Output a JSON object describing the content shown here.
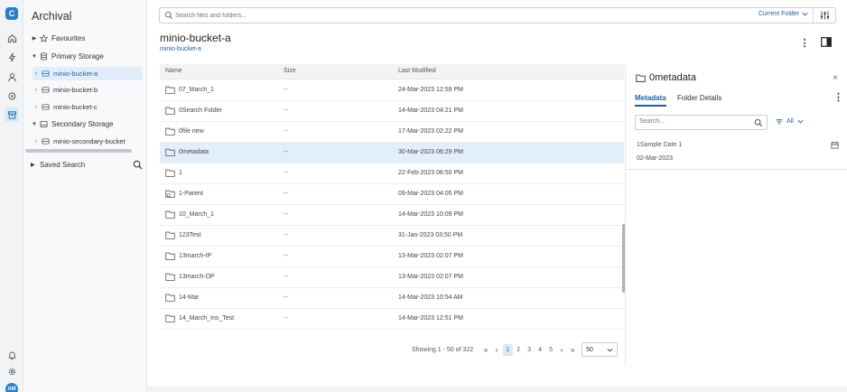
{
  "app": {
    "title": "Archival",
    "user_initials": "AM"
  },
  "rail": {
    "icons": [
      "home-icon",
      "bolt-icon",
      "users-icon",
      "gear-icon",
      "archive-icon",
      "bell-icon",
      "settings-icon"
    ]
  },
  "tree": {
    "favourites": "Favourites",
    "primary": "Primary Storage",
    "primary_children": [
      "minio-bucket-a",
      "minio-bucket-b",
      "minio-bucket-c"
    ],
    "secondary": "Secondary Storage",
    "secondary_children": [
      "minio-secondary-bucket"
    ],
    "saved_search": "Saved Search"
  },
  "search": {
    "placeholder": "Search files and folders...",
    "scope": "Current Folder"
  },
  "header": {
    "title": "minio-bucket-a",
    "breadcrumb": "minio-bucket-a"
  },
  "table": {
    "columns": {
      "name": "Name",
      "size": "Size",
      "modified": "Last Modified"
    },
    "rows": [
      {
        "name": "07_March_1",
        "size": "--",
        "modified": "24-Mar-2023 12:59 PM"
      },
      {
        "name": "0Search Folder",
        "size": "--",
        "modified": "14-Mar-2023 04:21 PM"
      },
      {
        "name": "0file new",
        "size": "--",
        "modified": "17-Mar-2023 02:22 PM"
      },
      {
        "name": "0metadata",
        "size": "--",
        "modified": "30-Mar-2023 06:29 PM",
        "selected": true
      },
      {
        "name": "1",
        "size": "--",
        "modified": "22-Feb-2023 08:50 PM"
      },
      {
        "name": "1-Parent",
        "size": "--",
        "modified": "09-Mar-2023 04:05 PM",
        "locked": true
      },
      {
        "name": "10_March_1",
        "size": "--",
        "modified": "14-Mar-2023 10:09 PM"
      },
      {
        "name": "123Test",
        "size": "--",
        "modified": "31-Jan-2023 03:50 PM"
      },
      {
        "name": "13march-IP",
        "size": "--",
        "modified": "13-Mar-2023 02:07 PM"
      },
      {
        "name": "13march-OP",
        "size": "--",
        "modified": "13-Mar-2023 02:07 PM"
      },
      {
        "name": "14-Mar",
        "size": "--",
        "modified": "14-Mar-2023 10:54 AM"
      },
      {
        "name": "14_March_Ins_Test",
        "size": "--",
        "modified": "14-Mar-2023 12:51 PM"
      }
    ]
  },
  "pagination": {
    "info": "Showing 1 - 50 of 322",
    "first": "«",
    "prev": "‹",
    "pages": [
      "1",
      "2",
      "3",
      "4",
      "5"
    ],
    "current": "1",
    "next": "›",
    "last": "»",
    "page_size": "50"
  },
  "details": {
    "title": "0metadata",
    "close": "×",
    "tabs": [
      "Metadata",
      "Folder Details"
    ],
    "search_placeholder": "Search...",
    "filter_label": "All",
    "field_label": "1Sample Date 1",
    "field_value": "02-Mar-2023"
  },
  "colors": {
    "accent": "#1f5f9e",
    "selected_row": "#e2eef9",
    "logo": "#2a7fc4"
  }
}
